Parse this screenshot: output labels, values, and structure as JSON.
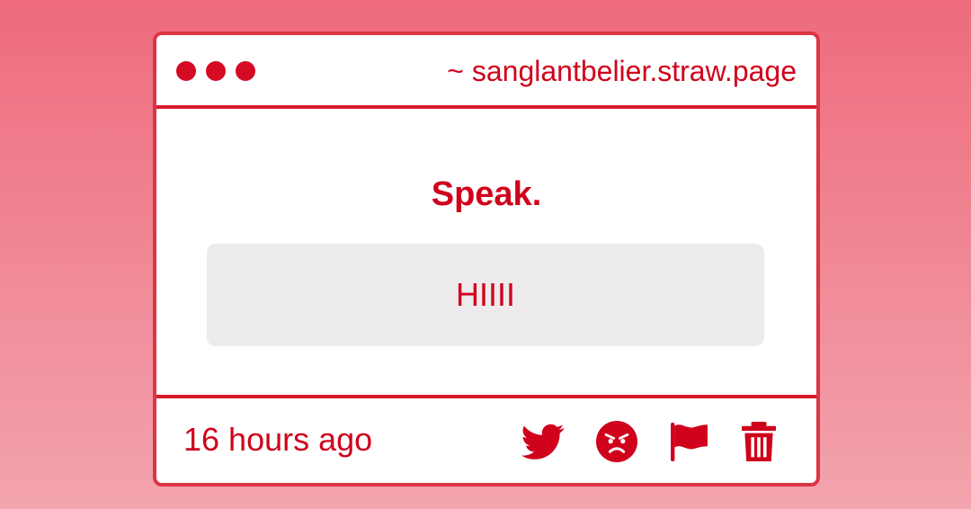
{
  "window": {
    "url": "~ sanglantbelier.straw.page"
  },
  "post": {
    "heading": "Speak.",
    "message": "HIIII",
    "timestamp": "16 hours ago"
  },
  "actions": [
    {
      "icon": "twitter-icon"
    },
    {
      "icon": "angry-face-icon"
    },
    {
      "icon": "flag-icon"
    },
    {
      "icon": "trash-icon"
    }
  ],
  "colors": {
    "accent": "#d0021b",
    "border": "#dc3545",
    "message_bg": "#edebec",
    "background_top": "#ee6b7c",
    "background_bottom": "#f3a4ae"
  }
}
